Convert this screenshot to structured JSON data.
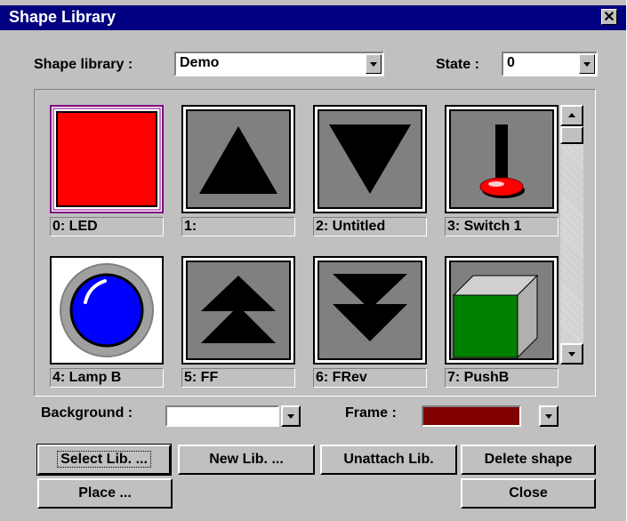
{
  "window": {
    "title": "Shape Library",
    "close_glyph": "✕"
  },
  "shape_library": {
    "label": "Shape library :",
    "value": "Demo"
  },
  "state": {
    "label": "State :",
    "value": "0"
  },
  "shapes": [
    {
      "caption": "0: LED",
      "icon": "led-red-square"
    },
    {
      "caption": "1:",
      "icon": "triangle-up"
    },
    {
      "caption": "2: Untitled",
      "icon": "triangle-down"
    },
    {
      "caption": "3: Switch 1",
      "icon": "toggle-switch"
    },
    {
      "caption": "4: Lamp B",
      "icon": "blue-lamp"
    },
    {
      "caption": "5: FF",
      "icon": "double-triangle-up"
    },
    {
      "caption": "6: FRev",
      "icon": "double-triangle-down"
    },
    {
      "caption": "7: PushB",
      "icon": "green-cube-pushbutton"
    }
  ],
  "background": {
    "label": "Background :",
    "color": "#ffffff"
  },
  "frame": {
    "label": "Frame :",
    "color": "#800000"
  },
  "buttons": {
    "select_lib": "Select Lib. ...",
    "new_lib": "New Lib. ...",
    "unattach_lib": "Unattach Lib.",
    "delete_shape": "Delete shape",
    "place": "Place ...",
    "close": "Close"
  }
}
